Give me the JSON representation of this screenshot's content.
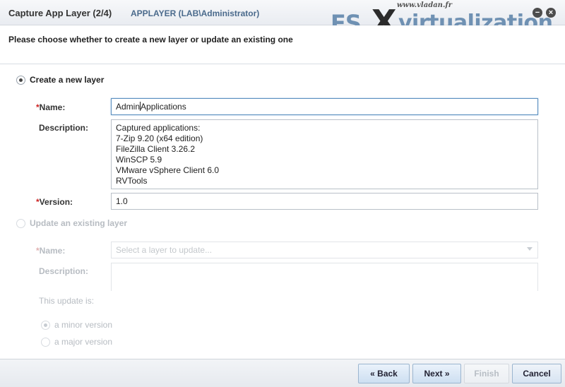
{
  "titlebar": {
    "title": "Capture App Layer (2/4)",
    "context": "APPLAYER (LAB\\Administrator)",
    "minimize_glyph": "−",
    "close_glyph": "×"
  },
  "watermark": {
    "url": "www.vladan.fr",
    "brand_es": "ES",
    "brand_x": "X",
    "brand_rest": "virtualization"
  },
  "instruction": "Please choose whether to create a new layer or update an existing one",
  "create_section": {
    "radio_label": "Create a new layer",
    "selected": true,
    "name_label": "Name:",
    "name_value_before_caret": "Admin",
    "name_value_after_caret": "Applications",
    "description_label": "Description:",
    "description_lines": [
      "Captured applications:",
      "7-Zip 9.20 (x64 edition)",
      "FileZilla Client 3.26.2",
      "WinSCP 5.9",
      "VMware vSphere Client 6.0",
      "RVTools"
    ],
    "version_label": "Version:",
    "version_value": "1.0",
    "required_mark": "*"
  },
  "update_section": {
    "radio_label": "Update an existing layer",
    "selected": false,
    "name_label": "Name:",
    "name_placeholder": "Select a layer to update...",
    "description_label": "Description:",
    "update_is_label": "This update is:",
    "options": [
      {
        "label": "a minor version",
        "selected": true
      },
      {
        "label": "a major version",
        "selected": false
      }
    ],
    "required_mark": "*"
  },
  "footer": {
    "back_label": "« Back",
    "next_label": "Next »",
    "finish_label": "Finish",
    "cancel_label": "Cancel"
  },
  "colors": {
    "accent": "#4a6a8c",
    "required": "#cc2222",
    "button_blue": "#cddff1",
    "disabled_text": "#b7bcc2"
  }
}
